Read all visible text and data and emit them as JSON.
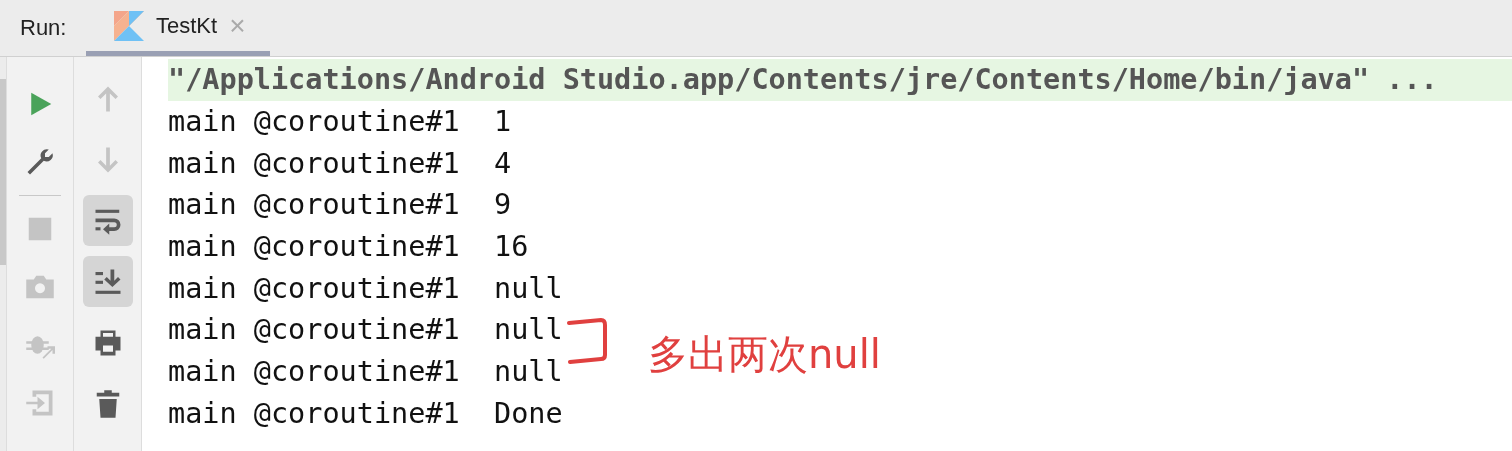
{
  "header": {
    "label": "Run:"
  },
  "tabs": [
    {
      "label": "TestKt",
      "close": "×",
      "selected": true
    }
  ],
  "left_toolbar": [
    {
      "kind": "run",
      "disabled": false
    },
    {
      "kind": "wrench",
      "disabled": false
    },
    {
      "kind": "separator"
    },
    {
      "kind": "stop",
      "disabled": true
    },
    {
      "kind": "camera",
      "disabled": true
    },
    {
      "kind": "bug",
      "disabled": true
    },
    {
      "kind": "exit",
      "disabled": true
    }
  ],
  "right_toolbar": [
    {
      "kind": "up",
      "disabled": true,
      "on": false
    },
    {
      "kind": "down",
      "disabled": true,
      "on": false
    },
    {
      "kind": "wrap",
      "disabled": false,
      "on": true
    },
    {
      "kind": "scroll",
      "disabled": false,
      "on": true
    },
    {
      "kind": "print",
      "disabled": false,
      "on": false
    },
    {
      "kind": "trash",
      "disabled": false,
      "on": false
    }
  ],
  "console": {
    "lines": [
      {
        "text": "\"/Applications/Android Studio.app/Contents/jre/Contents/Home/bin/java\" ...",
        "kind": "command"
      },
      {
        "text": "main @coroutine#1  1",
        "kind": "output"
      },
      {
        "text": "main @coroutine#1  4",
        "kind": "output"
      },
      {
        "text": "main @coroutine#1  9",
        "kind": "output"
      },
      {
        "text": "main @coroutine#1  16",
        "kind": "output"
      },
      {
        "text": "main @coroutine#1  null",
        "kind": "output"
      },
      {
        "text": "main @coroutine#1  null",
        "kind": "output"
      },
      {
        "text": "main @coroutine#1  null",
        "kind": "output"
      },
      {
        "text": "main @coroutine#1  Done",
        "kind": "output"
      }
    ]
  },
  "annotation": {
    "text": "多出两次null"
  }
}
